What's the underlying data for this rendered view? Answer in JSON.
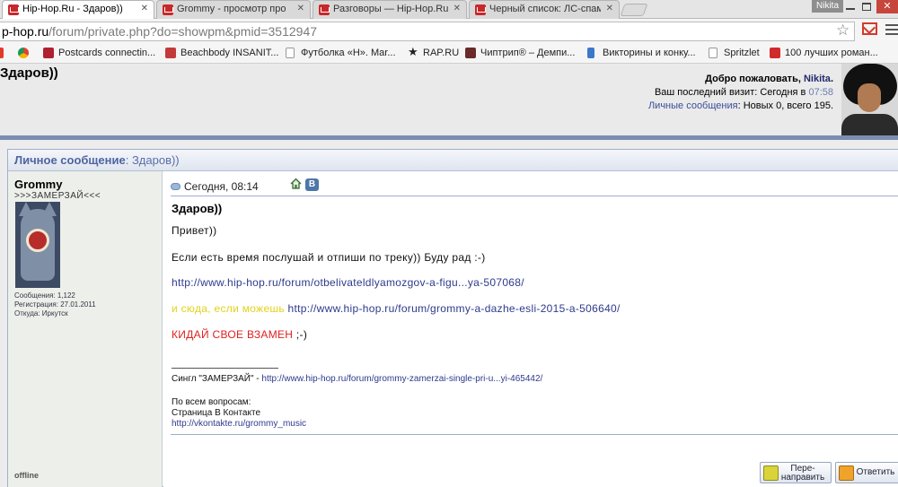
{
  "browser": {
    "tabs": [
      {
        "title": "Hip-Hop.Ru - Здаров))",
        "active": true
      },
      {
        "title": "Grommy - просмотр про",
        "active": false
      },
      {
        "title": "Разговоры — Hip-Hop.Ru",
        "active": false
      },
      {
        "title": "Черный список: ЛС-спам",
        "active": false
      }
    ],
    "profile_name": "Nikita",
    "url_host": "p-hop.ru",
    "url_path": "/forum/private.php?do=showpm&pmid=3512947",
    "bookmarks": [
      {
        "label": "Postcards connectin...",
        "icon": "postcrossing-icon",
        "color": "#b0202e"
      },
      {
        "label": "Beachbody INSANIT...",
        "icon": "beachbody-icon",
        "color": "#c43a3a"
      },
      {
        "label": "Футболка «Н». Mar...",
        "icon": "page-icon",
        "color": "#ffffff"
      },
      {
        "label": "RAP.RU",
        "icon": "star-icon",
        "color": "#222222"
      },
      {
        "label": "Чиптрип® – Демпи...",
        "icon": "chiptrip-icon",
        "color": "#6a2a2a"
      },
      {
        "label": "Викторины и конку...",
        "icon": "info-icon",
        "color": "#3c78c8"
      },
      {
        "label": "Spritzlet",
        "icon": "page-icon",
        "color": "#ffffff"
      },
      {
        "label": "100 лучших роман...",
        "icon": "a-icon",
        "color": "#d12a2a"
      }
    ]
  },
  "header": {
    "site_title": "Здаров))",
    "welcome_prefix": "Добро пожаловать,",
    "username": "Nikita",
    "last_visit_prefix": "Ваш последний визит: Сегодня в",
    "last_visit_time": "07:58",
    "pm_label": "Личные сообщения",
    "pm_counts": ": Новых 0, всего 195."
  },
  "pm": {
    "header_label": "Личное сообщение",
    "header_subject": ": Здаров))",
    "author": {
      "name": "Grommy",
      "title": ">>>ЗАМЕРЗАЙ<<<",
      "stats": [
        "Сообщения: 1,122",
        "Регистрация: 27.01.2011",
        "Откуда: Иркутск"
      ],
      "status": "offline"
    },
    "date": "Сегодня, 08:14",
    "vk_label": "В",
    "subject": "Здаров))",
    "greeting": "Привет))",
    "line1": "Если есть время послушай и отпиши по треку)) Буду рад :-)",
    "link1": "http://www.hip-hop.ru/forum/otbelivateldlyamozgov-a-figu...ya-507068/",
    "line2_prefix": "и сюда, если можешь",
    "link2": "http://www.hip-hop.ru/forum/grommy-a-dazhe-esli-2015-a-506640/",
    "line3_red": "КИДАЙ СВОЕ ВЗАМЕН",
    "line3_suffix": ";-)",
    "signature": {
      "single_prefix": "Сингл \"ЗАМЕРЗАЙ\" -",
      "single_link": "http://www.hip-hop.ru/forum/grommy-zamerzai-single-pri-u...yi-465442/",
      "questions": "По всем вопросам:",
      "vk_page": "Страница В Контакте",
      "vk_link": "http://vkontakte.ru/grommy_music"
    },
    "buttons": {
      "forward_line1": "Пере-",
      "forward_line2": "направить",
      "reply": "Ответить"
    }
  }
}
